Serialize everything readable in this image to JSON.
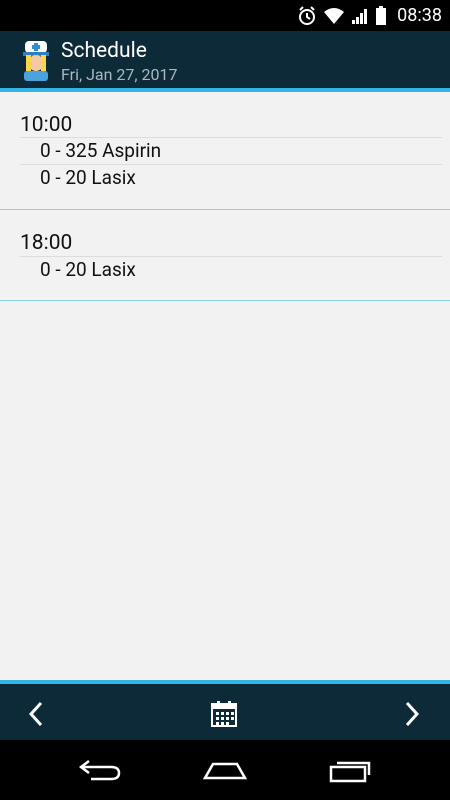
{
  "status_bar": {
    "time": "08:38",
    "icons": [
      "alarm-icon",
      "wifi-icon",
      "signal-icon",
      "battery-icon"
    ]
  },
  "app_bar": {
    "title": "Schedule",
    "subtitle": "Fri, Jan 27, 2017",
    "logo_icon": "nurse-icon"
  },
  "schedule": [
    {
      "time": "10:00",
      "items": [
        "0 - 325 Aspirin",
        "0 - 20 Lasix"
      ]
    },
    {
      "time": "18:00",
      "items": [
        "0 - 20 Lasix"
      ]
    }
  ],
  "bottom_bar": {
    "prev_icon": "chevron-left-icon",
    "calendar_icon": "calendar-icon",
    "next_icon": "chevron-right-icon"
  },
  "system_nav": {
    "back_icon": "back-icon",
    "home_icon": "home-icon",
    "recents_icon": "recents-icon"
  },
  "colors": {
    "accent": "#33b5e5",
    "bar_background": "#0d2a38",
    "page_background": "#f2f2f2"
  }
}
